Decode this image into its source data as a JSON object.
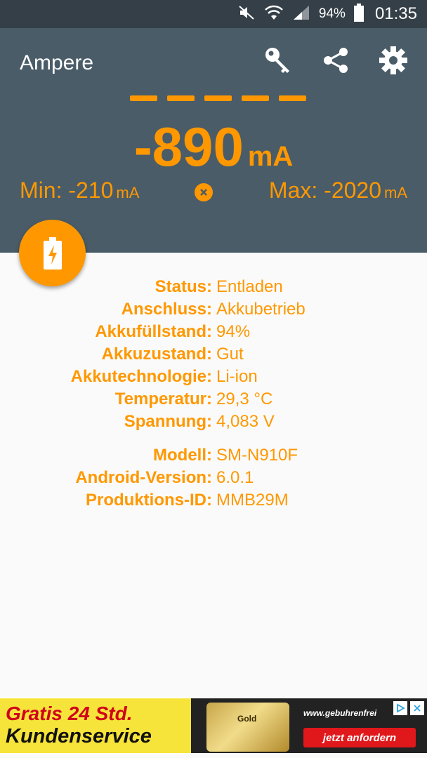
{
  "status_bar": {
    "battery_percent": "94%",
    "time": "01:35"
  },
  "app": {
    "title": "Ampere"
  },
  "toolbar": {
    "icons": [
      "key-icon",
      "share-icon",
      "settings-icon"
    ]
  },
  "meter": {
    "current_value": "-890",
    "current_unit": "mA",
    "min_label": "Min: -210",
    "min_unit": "mA",
    "max_label": "Max: -2020",
    "max_unit": "mA",
    "dashes": 5
  },
  "battery_info": [
    {
      "key": "Status:",
      "value": "Entladen"
    },
    {
      "key": "Anschluss:",
      "value": "Akkubetrieb"
    },
    {
      "key": "Akkufüllstand:",
      "value": "94%"
    },
    {
      "key": "Akkuzustand:",
      "value": "Gut"
    },
    {
      "key": "Akkutechnologie:",
      "value": "Li-ion"
    },
    {
      "key": "Temperatur:",
      "value": "29,3 °C"
    },
    {
      "key": "Spannung:",
      "value": "4,083 V"
    }
  ],
  "device_info": [
    {
      "key": "Modell:",
      "value": "SM-N910F"
    },
    {
      "key": "Android-Version:",
      "value": "6.0.1"
    },
    {
      "key": "Produktions-ID:",
      "value": "MMB29M"
    }
  ],
  "ad": {
    "line1": "Gratis 24 Std.",
    "line2": "Kundenservice",
    "card_label": "Gold",
    "url": "www.gebuhrenfrei",
    "cta": "jetzt anfordern"
  },
  "colors": {
    "accent": "#ff9800",
    "header": "#4a5c68",
    "status_bar": "#343f47",
    "background": "#fafafa"
  }
}
